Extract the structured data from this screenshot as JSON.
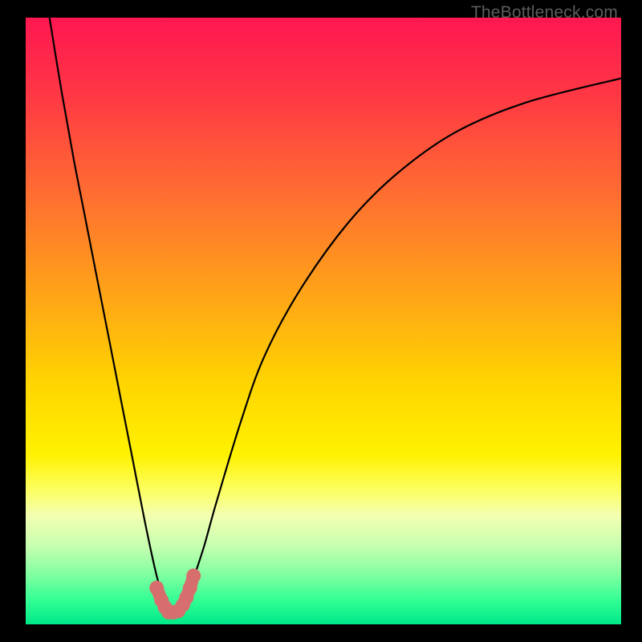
{
  "watermark": "TheBottleneck.com",
  "colors": {
    "black": "#000000",
    "curve": "#000000",
    "marker": "#d76e6e",
    "gradient_stops": [
      {
        "offset": 0.0,
        "color": "#ff1751"
      },
      {
        "offset": 0.12,
        "color": "#ff3545"
      },
      {
        "offset": 0.28,
        "color": "#ff6a33"
      },
      {
        "offset": 0.45,
        "color": "#ffa218"
      },
      {
        "offset": 0.6,
        "color": "#ffd400"
      },
      {
        "offset": 0.72,
        "color": "#fff200"
      },
      {
        "offset": 0.78,
        "color": "#fcff63"
      },
      {
        "offset": 0.82,
        "color": "#f3ffb0"
      },
      {
        "offset": 0.87,
        "color": "#c8ffb0"
      },
      {
        "offset": 0.92,
        "color": "#7dffa0"
      },
      {
        "offset": 0.96,
        "color": "#33ff95"
      },
      {
        "offset": 1.0,
        "color": "#00e888"
      }
    ]
  },
  "chart_data": {
    "type": "line",
    "title": "",
    "xlabel": "",
    "ylabel": "",
    "xlim": [
      0,
      100
    ],
    "ylim": [
      0,
      100
    ],
    "series": [
      {
        "name": "bottleneck-curve",
        "x": [
          4,
          6,
          8,
          10,
          12,
          14,
          16,
          18,
          20,
          22,
          23,
          24,
          25,
          26,
          27,
          28,
          30,
          32,
          36,
          40,
          46,
          54,
          62,
          72,
          84,
          100
        ],
        "values": [
          100,
          88,
          77,
          67,
          57,
          47,
          37,
          27,
          17,
          8,
          5,
          3,
          2,
          2,
          4,
          7,
          13,
          20,
          33,
          44,
          55,
          66,
          74,
          81,
          86,
          90
        ]
      }
    ],
    "markers": {
      "name": "highlighted-segment",
      "x": [
        22.0,
        22.8,
        23.4,
        24.0,
        24.8,
        25.6,
        26.4,
        27.0,
        27.6,
        28.2
      ],
      "values": [
        6.0,
        4.0,
        2.8,
        2.0,
        2.0,
        2.2,
        3.2,
        4.4,
        6.0,
        8.0
      ]
    }
  }
}
